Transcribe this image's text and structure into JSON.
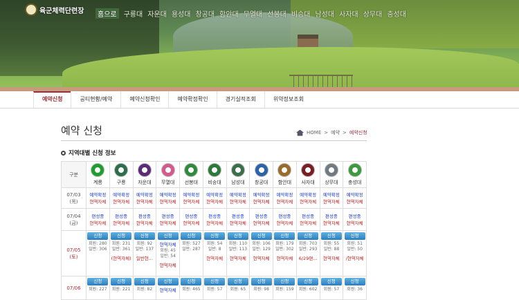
{
  "brand": {
    "logo_text": "육군체력단련장"
  },
  "topnav": [
    "홈으로",
    "구룡대",
    "자운대",
    "용성대",
    "창공대",
    "함안대",
    "무열대",
    "선봉대",
    "비승대",
    "남성대",
    "사자대",
    "상무대",
    "충성대"
  ],
  "subnav": [
    "예약신청",
    "공티현황/예약",
    "예약신청확인",
    "예약확정확인",
    "경기실적조회",
    "위약정보조회"
  ],
  "page_title": "예약 신청",
  "breadcrumb": {
    "home": "HOME",
    "sep": ">",
    "mid": "예약",
    "current": "예약신청"
  },
  "section_title": "지역대별 신청 정보",
  "table": {
    "corner": "구분",
    "clubs": [
      {
        "name": "계룡",
        "color": "#1f9e2f"
      },
      {
        "name": "구룡",
        "color": "#2c6f4a"
      },
      {
        "name": "자운대",
        "color": "#5b2a7a"
      },
      {
        "name": "무열대",
        "color": "#d45a8e"
      },
      {
        "name": "선봉대",
        "color": "#2f8a3c"
      },
      {
        "name": "비승대",
        "color": "#2b7a3a"
      },
      {
        "name": "남성대",
        "color": "#3a6f4c"
      },
      {
        "name": "창공대",
        "color": "#2c62a8"
      },
      {
        "name": "함안대",
        "color": "#9a6b2a"
      },
      {
        "name": "사자대",
        "color": "#7a1e26"
      },
      {
        "name": "상무대",
        "color": "#6f7a82"
      },
      {
        "name": "충성대",
        "color": "#3b9a3b"
      }
    ],
    "rows": [
      {
        "date": "07/03",
        "day": "(목)",
        "red": false,
        "cells": [
          [
            "예약확정",
            "현역자체"
          ],
          [
            "예약확정",
            "현역자체"
          ],
          [
            "예약확정",
            "현역자체"
          ],
          [
            "예약확정",
            "현역자체"
          ],
          [
            "예약확정",
            "현역자체"
          ],
          [
            "예약확정",
            "현역자체"
          ],
          [
            "예약확정",
            "현역자체"
          ],
          [
            "예약확정",
            "현역자체"
          ],
          [
            "예약확정",
            "현역자체"
          ],
          [
            "예약확정",
            "현역자체"
          ],
          [
            "예약확정",
            "현역자체"
          ],
          [
            "예약확정",
            "현역자체"
          ]
        ]
      },
      {
        "date": "07/04",
        "day": "(금)",
        "red": false,
        "cells": [
          [
            "편성중",
            "현역자체"
          ],
          [
            "편성중",
            "현역자체"
          ],
          [
            "편성중",
            "현역자체"
          ],
          [
            "편성중",
            "현역자체"
          ],
          [
            "편성중",
            "현역자체"
          ],
          [
            "편성중",
            "현역자체"
          ],
          [
            "편성중",
            "현역자체"
          ],
          [
            "편성중",
            "현역자체"
          ],
          [
            "편성중",
            "현역자체"
          ],
          [
            "편성중",
            "현역자체"
          ],
          [
            "편성중",
            "현역자체"
          ],
          [
            "편성중",
            "현역자체"
          ]
        ]
      },
      {
        "date": "07/05",
        "day": "(토)",
        "red": true,
        "cells": [
          {
            "btn": "신청",
            "a": "회원: 280",
            "b": "일반: 306",
            "note": ""
          },
          {
            "btn": "신청",
            "a": "회원: 231",
            "b": "일반: 361",
            "note": "(현역자체)"
          },
          {
            "btn": "신청",
            "a": "회원: 92",
            "b": "일반: 137",
            "note": "일반현..."
          },
          {
            "btn": "신청",
            "top": "현역자체",
            "a": "회원: 45",
            "b": "일반: 54",
            "note": "현역자체"
          },
          {
            "btn": "신청",
            "a": "회원: 527",
            "b": "일반: 287",
            "note": ""
          },
          {
            "btn": "신청",
            "a": "회원: 54",
            "b": "일반: 8",
            "note": "현역자체"
          },
          {
            "btn": "신청",
            "a": "회원: 110",
            "b": "일반: 113",
            "note": "현역자체"
          },
          {
            "btn": "신청",
            "a": "회원: 106",
            "b": "일반: 129",
            "note": "현역자체"
          },
          {
            "btn": "신청",
            "a": "회원: 179",
            "b": "일반: 302",
            "note": "현역자체"
          },
          {
            "btn": "신청",
            "a": "회원: 703",
            "b": "일반: 293",
            "note": "6/29편..."
          },
          {
            "btn": "신청",
            "a": "회원: 55",
            "b": "일반: 88",
            "note": "현역자체"
          },
          {
            "btn": "신청",
            "a": "회원: 51",
            "b": "일반: 50",
            "note": "/현역자체"
          }
        ]
      },
      {
        "date": "07/06",
        "day": "",
        "red": true,
        "cells": [
          {
            "btn": "신청",
            "a": "회원: 227",
            "b": ""
          },
          {
            "btn": "신청",
            "a": "회원: 221",
            "b": ""
          },
          {
            "btn": "신청",
            "a": "회원: 82",
            "b": ""
          },
          {
            "btn": "신청",
            "top": "현역자체",
            "a": "",
            "b": ""
          },
          {
            "btn": "신청",
            "a": "회원: 465",
            "b": ""
          },
          {
            "btn": "신청",
            "a": "회원: 57",
            "b": ""
          },
          {
            "btn": "신청",
            "a": "회원: 65",
            "b": ""
          },
          {
            "btn": "신청",
            "a": "회원: 98",
            "b": ""
          },
          {
            "btn": "신청",
            "a": "회원: 159",
            "b": ""
          },
          {
            "btn": "신청",
            "a": "회원: 602",
            "b": ""
          },
          {
            "btn": "신청",
            "a": "회원: 57",
            "b": ""
          },
          {
            "btn": "신청",
            "a": "회원: 36",
            "b": ""
          }
        ]
      }
    ]
  }
}
